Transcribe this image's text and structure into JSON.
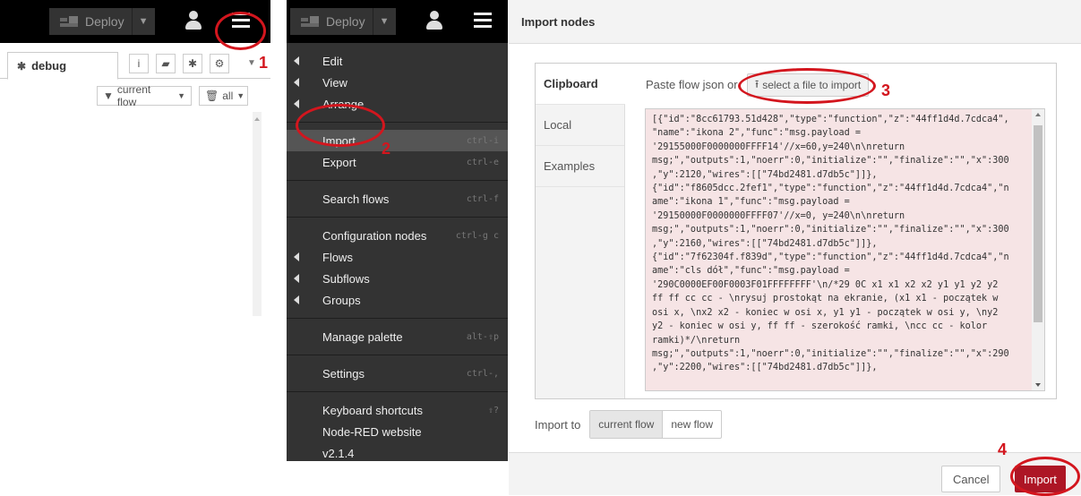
{
  "header": {
    "deploy_label": "Deploy"
  },
  "sidebar": {
    "tab_label": "debug",
    "filter_label": "current flow",
    "clear_label": "all"
  },
  "menu": {
    "items": [
      {
        "label": "Edit",
        "shortcut": "",
        "submenu": true
      },
      {
        "label": "View",
        "shortcut": "",
        "submenu": true
      },
      {
        "label": "Arrange",
        "shortcut": "",
        "submenu": true
      },
      {
        "label": "Import",
        "shortcut": "ctrl-i",
        "submenu": false
      },
      {
        "label": "Export",
        "shortcut": "ctrl-e",
        "submenu": false
      },
      {
        "label": "Search flows",
        "shortcut": "ctrl-f",
        "submenu": false
      },
      {
        "label": "Configuration nodes",
        "shortcut": "ctrl-g c",
        "submenu": false
      },
      {
        "label": "Flows",
        "shortcut": "",
        "submenu": true
      },
      {
        "label": "Subflows",
        "shortcut": "",
        "submenu": true
      },
      {
        "label": "Groups",
        "shortcut": "",
        "submenu": true
      },
      {
        "label": "Manage palette",
        "shortcut": "alt-⇧p",
        "submenu": false
      },
      {
        "label": "Settings",
        "shortcut": "ctrl-,",
        "submenu": false
      },
      {
        "label": "Keyboard shortcuts",
        "shortcut": "⇧?",
        "submenu": false
      },
      {
        "label": "Node-RED website",
        "shortcut": "",
        "submenu": false
      },
      {
        "label": "v2.1.4",
        "shortcut": "",
        "submenu": false
      }
    ]
  },
  "dialog": {
    "title": "Import nodes",
    "tabs": [
      "Clipboard",
      "Local",
      "Examples"
    ],
    "paste_label": "Paste flow json or",
    "file_button": "select a file to import",
    "json_lines": [
      "[{\"id\":\"8cc61793.51d428\",\"type\":\"function\",\"z\":\"44ff1d4d.7cdca4\",",
      "\"name\":\"ikona 2\",\"func\":\"msg.payload =",
      "'29155000F0000000FFFF14'//x=60,y=240\\n\\nreturn",
      "msg;\",\"outputs\":1,\"noerr\":0,\"initialize\":\"\",\"finalize\":\"\",\"x\":300",
      ",\"y\":2120,\"wires\":[[\"74bd2481.d7db5c\"]]},",
      "{\"id\":\"f8605dcc.2fef1\",\"type\":\"function\",\"z\":\"44ff1d4d.7cdca4\",\"n",
      "ame\":\"ikona 1\",\"func\":\"msg.payload =",
      "'29150000F0000000FFFF07'//x=0, y=240\\n\\nreturn",
      "msg;\",\"outputs\":1,\"noerr\":0,\"initialize\":\"\",\"finalize\":\"\",\"x\":300",
      ",\"y\":2160,\"wires\":[[\"74bd2481.d7db5c\"]]},",
      "{\"id\":\"7f62304f.f839d\",\"type\":\"function\",\"z\":\"44ff1d4d.7cdca4\",\"n",
      "ame\":\"cls dół\",\"func\":\"msg.payload =",
      "'290C0000EF00F0003F01FFFFFFFF'\\n/*29 0C x1 x1 x2 x2 y1 y1 y2 y2",
      "ff ff cc cc - \\nrysuj prostokąt na ekranie, (x1 x1 - początek w",
      "osi x, \\nx2 x2 - koniec w osi x, y1 y1 - początek w osi y, \\ny2",
      "y2 - koniec w osi y, ff ff - szerokość ramki, \\ncc cc - kolor",
      "ramki)*/\\nreturn",
      "msg;\",\"outputs\":1,\"noerr\":0,\"initialize\":\"\",\"finalize\":\"\",\"x\":290",
      ",\"y\":2200,\"wires\":[[\"74bd2481.d7db5c\"]]},"
    ],
    "import_to_label": "Import to",
    "import_to_options": [
      "current flow",
      "new flow"
    ],
    "cancel_label": "Cancel",
    "import_label": "Import"
  },
  "annotations": {
    "step_numbers": [
      "1",
      "2",
      "3",
      "4"
    ],
    "color": "#d3161e"
  },
  "colors": {
    "header_bg": "#000000",
    "menu_bg": "#333333",
    "import_button": "#ad1625",
    "json_bg": "#f6e4e5"
  }
}
